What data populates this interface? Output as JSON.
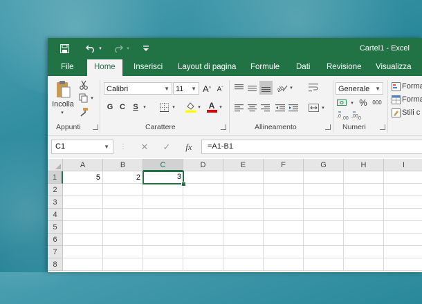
{
  "window": {
    "title": "Cartel1 - Excel",
    "accent_color": "#217346"
  },
  "quick_access": {
    "save_icon": "save-icon",
    "undo_icon": "undo-icon",
    "redo_icon": "redo-icon",
    "customize_icon": "customize-icon"
  },
  "tabs": [
    {
      "label": "File",
      "active": false
    },
    {
      "label": "Home",
      "active": true
    },
    {
      "label": "Inserisci",
      "active": false
    },
    {
      "label": "Layout di pagina",
      "active": false
    },
    {
      "label": "Formule",
      "active": false
    },
    {
      "label": "Dati",
      "active": false
    },
    {
      "label": "Revisione",
      "active": false
    },
    {
      "label": "Visualizza",
      "active": false
    }
  ],
  "ribbon": {
    "clipboard": {
      "label": "Appunti",
      "paste_label": "Incolla"
    },
    "font": {
      "label": "Carattere",
      "font_name": "Calibri",
      "font_size": "11",
      "grow": "A",
      "shrink": "A",
      "bold": "G",
      "italic": "C",
      "underline": "S",
      "fill_color": "#ffff00",
      "font_color": "#e00000",
      "font_color_letter": "A"
    },
    "alignment": {
      "label": "Allineamento"
    },
    "number": {
      "label": "Numeri",
      "format": "Generale",
      "percent": "%",
      "thousands": "000"
    },
    "styles": {
      "cond_format": "Forma",
      "table_format": "Forma",
      "cell_styles": "Stili c"
    }
  },
  "formula_bar": {
    "name_box": "C1",
    "cancel": "✕",
    "enter": "✓",
    "fx": "fx",
    "formula": "=A1-B1"
  },
  "grid": {
    "columns": [
      "A",
      "B",
      "C",
      "D",
      "E",
      "F",
      "G",
      "H",
      "I"
    ],
    "rows": [
      "1",
      "2",
      "3",
      "4",
      "5",
      "6",
      "7",
      "8"
    ],
    "selected_cell": "C1",
    "cells": {
      "A1": "5",
      "B1": "2",
      "C1": "3"
    }
  }
}
